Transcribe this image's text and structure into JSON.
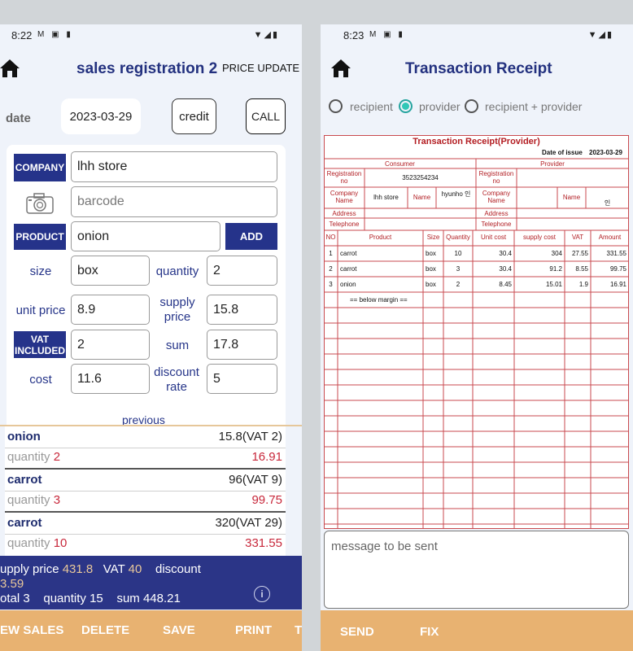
{
  "left": {
    "status": {
      "time": "8:22",
      "icons": "M ▣ ▮",
      "right_icons": "▼◢▮"
    },
    "header": {
      "title": "sales registration 2",
      "price_update": "PRICE UPDATE"
    },
    "date_label": "date",
    "date_value": "2023-03-29",
    "credit_button": "credit",
    "call_button": "CALL",
    "form": {
      "company_label": "COMPANY",
      "company_value": "lhh store",
      "barcode_placeholder": "barcode",
      "product_label": "PRODUCT",
      "product_value": "onion",
      "add_button": "ADD",
      "size_label": "size",
      "size_value": "box",
      "quantity_label": "quantity",
      "quantity_value": "2",
      "unit_price_label": "unit price",
      "unit_price_value": "8.9",
      "supply_price_label": "supply price",
      "supply_price_value": "15.8",
      "vat_label": "VAT INCLUDED",
      "vat_value": "2",
      "sum_label": "sum",
      "sum_value": "17.8",
      "cost_label": "cost",
      "cost_value": "11.6",
      "discount_label": "discount rate",
      "discount_value": "5",
      "previous_label": "previous"
    },
    "items": [
      {
        "name": "onion",
        "total": "15.8(VAT 2)",
        "qty_label": "quantity",
        "qty": "2",
        "amount": "16.91"
      },
      {
        "name": "carrot",
        "total": "96(VAT 9)",
        "qty_label": "quantity",
        "qty": "3",
        "amount": "99.75"
      },
      {
        "name": "carrot",
        "total": "320(VAT 29)",
        "qty_label": "quantity",
        "qty": "10",
        "amount": "331.55"
      }
    ],
    "summary": {
      "supply_label": "upply price",
      "supply_value": "431.8",
      "vat_label": "VAT",
      "vat_value": "40",
      "discount_label": "discount",
      "discount_value": "3.59",
      "total_label": "otal",
      "total_value": "3",
      "quantity_label": "quantity",
      "quantity_value": "15",
      "sum_label": "sum",
      "sum_value": "448.21"
    },
    "bottom": {
      "new_sales": "EW SALES",
      "delete": "DELETE",
      "save": "SAVE",
      "print": "PRINT",
      "more": "T"
    }
  },
  "right": {
    "status": {
      "time": "8:23",
      "icons": "M ▣ ▮",
      "right_icons": "▼◢▮"
    },
    "header": {
      "title": "Transaction Receipt"
    },
    "radios": [
      "recipient",
      "provider",
      "recipient + provider"
    ],
    "receipt": {
      "title": "Transaction Receipt(Provider)",
      "date_of_issue_label": "Date of issue",
      "date_of_issue": "2023-03-29",
      "consumer": "Consumer",
      "provider": "Provider",
      "registration_no_label": "Registration no",
      "registration_no_value": "3523254234",
      "company_name_label": "Company Name",
      "company_name_value": "lhh store",
      "name_label": "Name",
      "name_value": "hyunho 인",
      "provider_name_value": "인",
      "address_label": "Address",
      "telephone_label": "Telephone",
      "columns": [
        "NO",
        "Product",
        "Size",
        "Quantity",
        "Unit cost",
        "supply cost",
        "VAT",
        "Amount"
      ],
      "rows": [
        [
          "1",
          "carrot",
          "box",
          "10",
          "30.4",
          "304",
          "27.55",
          "331.55"
        ],
        [
          "2",
          "carrot",
          "box",
          "3",
          "30.4",
          "91.2",
          "8.55",
          "99.75"
        ],
        [
          "3",
          "onion",
          "box",
          "2",
          "8.45",
          "15.01",
          "1.9",
          "16.91"
        ]
      ],
      "below_margin": "== below margin =="
    },
    "message_placeholder": "message to be sent",
    "bottom": {
      "send": "SEND",
      "fix": "FIX"
    }
  },
  "colors": {
    "navy": "#25338a",
    "bottom_bar": "#e8b271",
    "receipt_red": "#b31d22",
    "teal": "#2fc7b6"
  }
}
